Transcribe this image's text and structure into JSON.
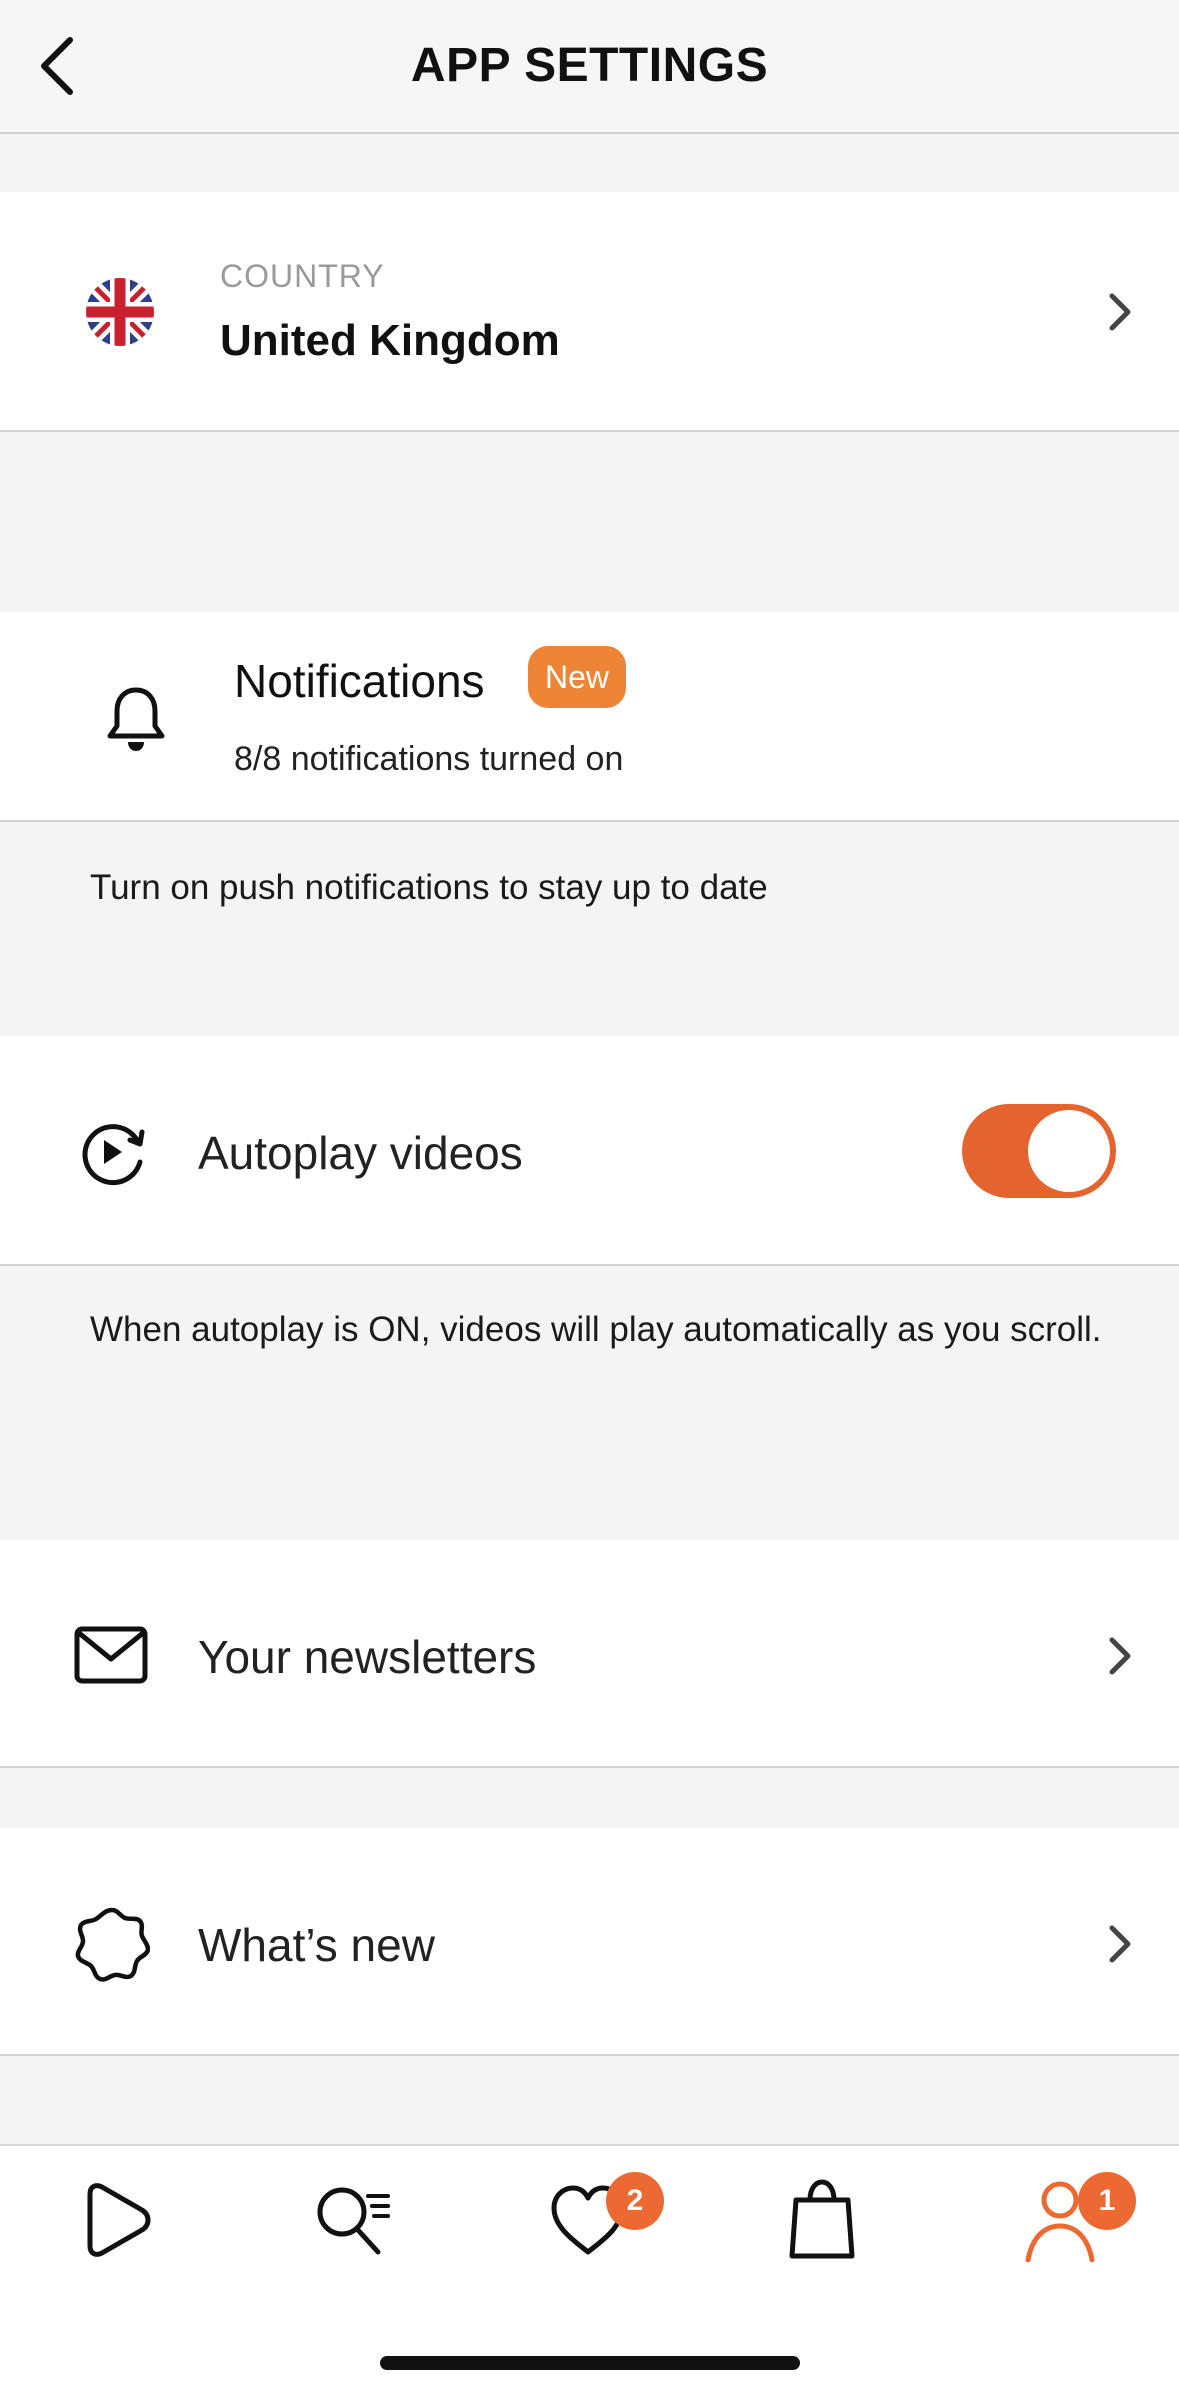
{
  "header": {
    "title": "APP SETTINGS"
  },
  "country": {
    "label": "COUNTRY",
    "value": "United Kingdom"
  },
  "notifications": {
    "title": "Notifications",
    "badge": "New",
    "subtitle": "8/8 notifications turned on",
    "info": "Turn on push notifications to stay up to date"
  },
  "autoplay": {
    "label": "Autoplay videos",
    "enabled": true,
    "info": "When autoplay is ON, videos will play automatically as you scroll."
  },
  "rows": {
    "newsletters": "Your newsletters",
    "whats_new": "What’s new"
  },
  "bottom_nav": {
    "items": [
      {
        "icon": "play-icon"
      },
      {
        "icon": "search-icon"
      },
      {
        "icon": "heart-icon",
        "badge": "2"
      },
      {
        "icon": "bag-icon"
      },
      {
        "icon": "profile-icon",
        "badge": "1"
      }
    ]
  },
  "colors": {
    "accent": "#e5632e",
    "badge": "#ee8436",
    "active_nav": "#ec6a32"
  }
}
